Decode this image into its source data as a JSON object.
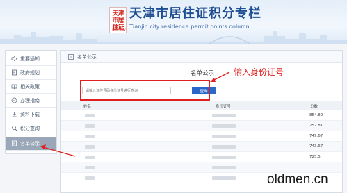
{
  "banner": {
    "logo_text": "天津市居住证",
    "logo_sub": "Tianjin City",
    "title": "天津市居住证积分专栏",
    "subtitle": "Tianjin city residence permit points column"
  },
  "sidebar": {
    "items": [
      {
        "label": "重要通知",
        "icon": "speaker-icon"
      },
      {
        "label": "政府规划",
        "icon": "document-list-icon"
      },
      {
        "label": "相关政策",
        "icon": "book-icon"
      },
      {
        "label": "办理指南",
        "icon": "guide-icon"
      },
      {
        "label": "资料下载",
        "icon": "download-icon"
      },
      {
        "label": "积分查询",
        "icon": "query-icon"
      },
      {
        "label": "名单公示",
        "icon": "list-icon",
        "active": true
      }
    ]
  },
  "panel": {
    "header_label": "名单公示",
    "title": "名单公示",
    "search_label": "",
    "search_placeholder": "请输入证件号码身份证号进行查询",
    "search_button": "查询"
  },
  "table": {
    "columns": [
      "姓名",
      "身份证号",
      "分数"
    ],
    "rows": [
      {
        "name": "",
        "id": "",
        "score": "854.82"
      },
      {
        "name": "",
        "id": "",
        "score": "757.81"
      },
      {
        "name": "",
        "id": "",
        "score": "749.67"
      },
      {
        "name": "",
        "id": "",
        "score": "743.67"
      },
      {
        "name": "",
        "id": "",
        "score": "725.5"
      },
      {
        "name": "",
        "id": "",
        "score": ""
      },
      {
        "name": "",
        "id": "",
        "score": ""
      }
    ]
  },
  "annotation": {
    "text": "输入身份证号",
    "color": "#e02020"
  },
  "watermark": "oldmen.cn",
  "colors": {
    "brand_blue": "#1f4f93",
    "button_blue": "#2c66c8",
    "annotation_red": "#e02020",
    "sidebar_active": "#9aa7b8"
  }
}
